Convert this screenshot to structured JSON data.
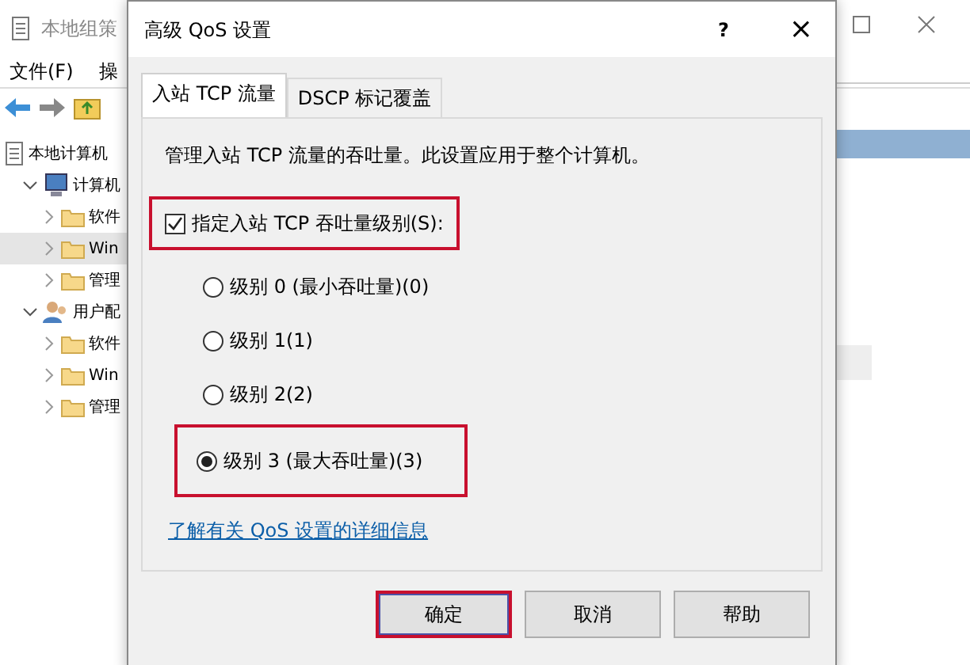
{
  "background_window": {
    "title": "本地组策",
    "menu": [
      "文件(F)",
      "操"
    ],
    "tree": [
      {
        "label": "本地计算机",
        "kind": "root",
        "children": [
          {
            "label": "计算机",
            "kind": "computer",
            "expanded": true,
            "children": [
              {
                "label": "软件",
                "kind": "folder",
                "selected": false
              },
              {
                "label": "Win",
                "kind": "folder",
                "selected": true
              },
              {
                "label": "管理",
                "kind": "folder",
                "selected": false
              }
            ]
          },
          {
            "label": "用户配",
            "kind": "user",
            "expanded": true,
            "children": [
              {
                "label": "软件",
                "kind": "folder",
                "selected": false
              },
              {
                "label": "Win",
                "kind": "folder",
                "selected": false
              },
              {
                "label": "管理",
                "kind": "folder",
                "selected": false
              }
            ]
          }
        ]
      }
    ]
  },
  "dialog": {
    "title": "高级 QoS 设置",
    "help": "?",
    "close": "×",
    "tabs": [
      {
        "label": "入站 TCP 流量",
        "selected": true
      },
      {
        "label": "DSCP 标记覆盖",
        "selected": false
      }
    ],
    "description": "管理入站 TCP 流量的吞吐量。此设置应用于整个计算机。",
    "checkbox": {
      "label": "指定入站 TCP 吞吐量级别(S):",
      "checked": true,
      "highlighted": true
    },
    "options": [
      {
        "label": "级别 0 (最小吞吐量)(0)",
        "selected": false,
        "highlighted": false
      },
      {
        "label": "级别 1(1)",
        "selected": false,
        "highlighted": false
      },
      {
        "label": "级别 2(2)",
        "selected": false,
        "highlighted": false
      },
      {
        "label": "级别 3 (最大吞吐量)(3)",
        "selected": true,
        "highlighted": true
      }
    ],
    "link": "了解有关 QoS 设置的详细信息",
    "buttons": [
      {
        "label": "确定",
        "highlighted": true
      },
      {
        "label": "取消",
        "highlighted": false
      },
      {
        "label": "帮助",
        "highlighted": false
      }
    ]
  }
}
